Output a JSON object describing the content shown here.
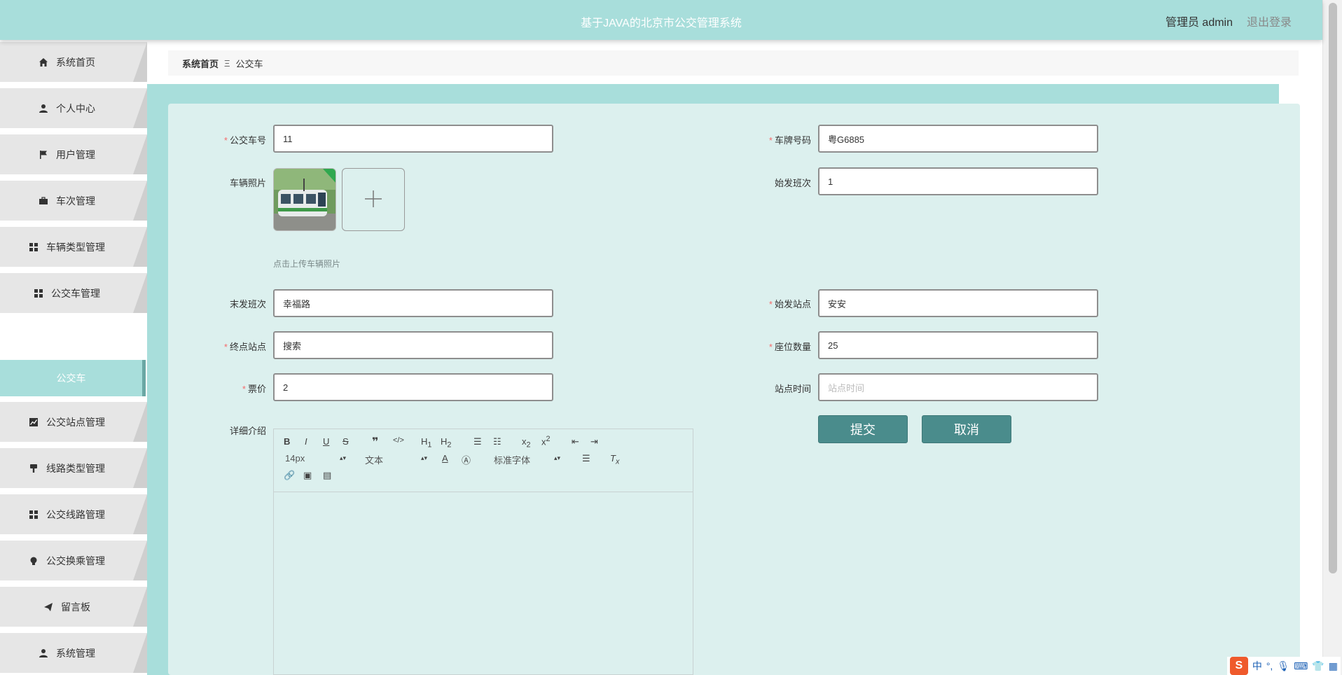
{
  "header": {
    "title": "基于JAVA的北京市公交管理系统",
    "user": "管理员 admin",
    "logout": "退出登录"
  },
  "sidebar": {
    "items": [
      {
        "label": "系统首页",
        "icon": "home-icon"
      },
      {
        "label": "个人中心",
        "icon": "user-icon"
      },
      {
        "label": "用户管理",
        "icon": "flag-icon"
      },
      {
        "label": "车次管理",
        "icon": "briefcase-icon"
      },
      {
        "label": "车辆类型管理",
        "icon": "grid-icon"
      },
      {
        "label": "公交车管理",
        "icon": "grid-icon"
      },
      {
        "label": "公交站点管理",
        "icon": "chart-icon"
      },
      {
        "label": "线路类型管理",
        "icon": "brush-icon"
      },
      {
        "label": "公交线路管理",
        "icon": "grid-icon"
      },
      {
        "label": "公交换乘管理",
        "icon": "bulb-icon"
      },
      {
        "label": "留言板",
        "icon": "send-icon"
      },
      {
        "label": "系统管理",
        "icon": "user-icon"
      }
    ],
    "active_sub": "公交车"
  },
  "breadcrumb": {
    "home": "系统首页",
    "separator": "Ξ",
    "current": "公交车"
  },
  "form": {
    "bus_no": {
      "label": "公交车号",
      "required": "*",
      "value": "11"
    },
    "plate": {
      "label": "车牌号码",
      "required": "*",
      "value": "粤G6885"
    },
    "photo": {
      "label": "车辆照片",
      "hint": "点击上传车辆照片"
    },
    "first_trip": {
      "label": "始发班次",
      "value": "1"
    },
    "last_trip": {
      "label": "末发班次",
      "value": "幸福路"
    },
    "start_station": {
      "label": "始发站点",
      "required": "*",
      "value": "安安"
    },
    "end_station": {
      "label": "终点站点",
      "required": "*",
      "value": "搜索"
    },
    "seats": {
      "label": "座位数量",
      "required": "*",
      "value": "25"
    },
    "fare": {
      "label": "票价",
      "required": "*",
      "value": "2"
    },
    "station_time": {
      "label": "站点时间",
      "placeholder": "站点时间"
    },
    "detail": {
      "label": "详细介绍"
    }
  },
  "editor": {
    "font_size": "14px",
    "block_type": "文本",
    "font_family": "标准字体"
  },
  "buttons": {
    "submit": "提交",
    "cancel": "取消"
  },
  "tray": {
    "ime": "中",
    "punct": "°,"
  },
  "colors": {
    "header_bg": "#a8dedb",
    "card_bg": "#dcf0ee",
    "button_bg": "#4a8c8c",
    "required": "#f56c6c"
  }
}
